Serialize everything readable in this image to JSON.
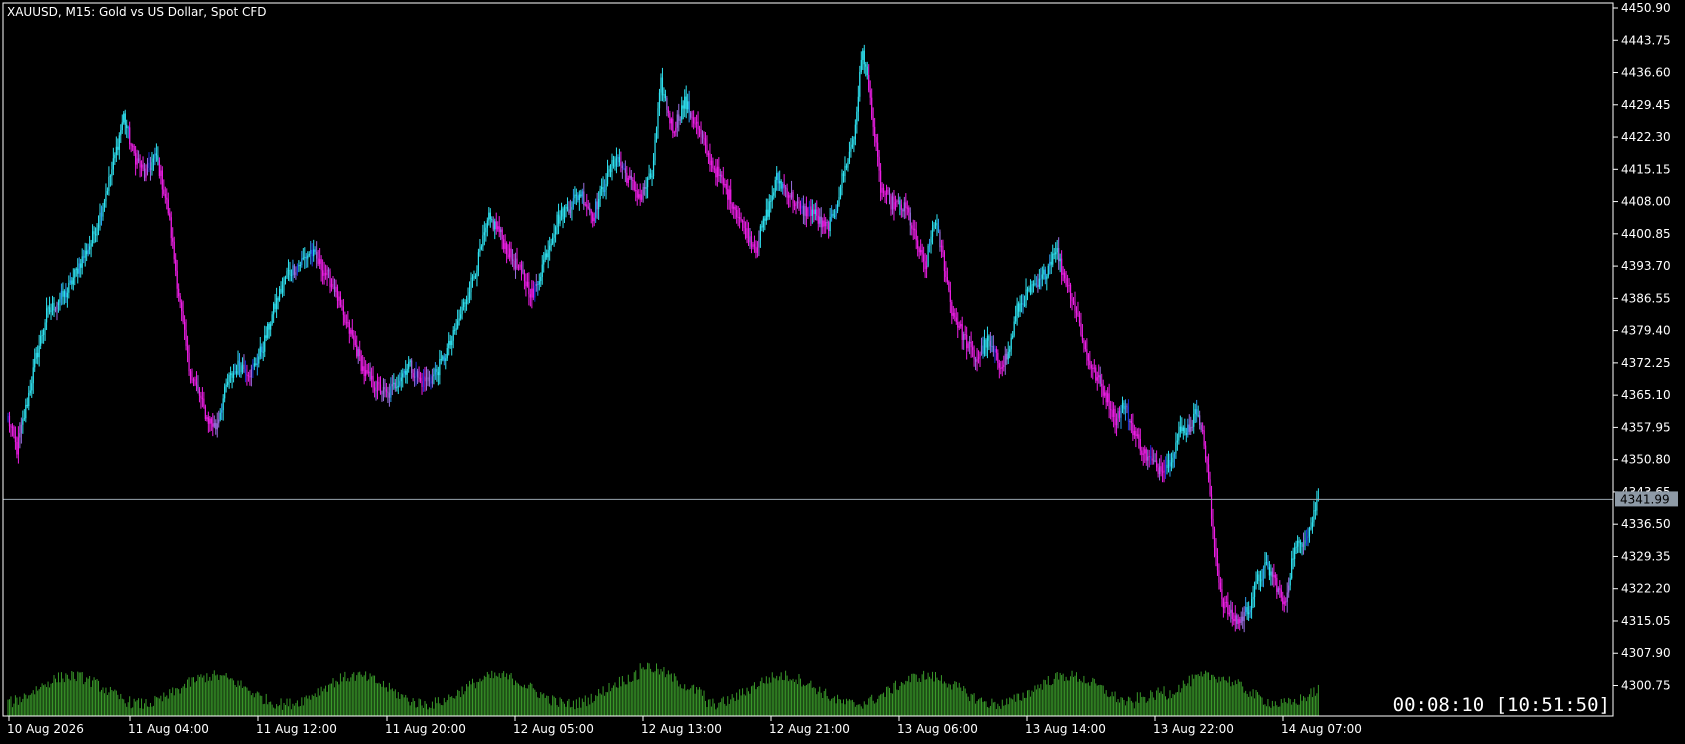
{
  "chart_data": {
    "type": "candlestick",
    "title": "XAUUSD, M15:  Gold vs US Dollar, Spot CFD",
    "symbol": "XAUUSD",
    "timeframe": "M15",
    "description": "Gold vs US Dollar, Spot CFD",
    "ylim": [
      4296.5,
      4452.5
    ],
    "grid": false,
    "y_ticks": [
      "4450.90",
      "4443.75",
      "4436.60",
      "4429.45",
      "4422.30",
      "4415.15",
      "4408.00",
      "4400.85",
      "4393.70",
      "4386.55",
      "4379.40",
      "4372.25",
      "4365.10",
      "4357.95",
      "4350.80",
      "4343.65",
      "4336.50",
      "4329.35",
      "4322.20",
      "4315.05",
      "4307.90",
      "4300.75"
    ],
    "x_ticks": [
      "10 Aug 2026",
      "11 Aug 04:00",
      "11 Aug 12:00",
      "11 Aug 20:00",
      "12 Aug 05:00",
      "12 Aug 13:00",
      "12 Aug 21:00",
      "13 Aug 06:00",
      "13 Aug 14:00",
      "13 Aug 22:00",
      "14 Aug 07:00"
    ],
    "current_price": 4341.99,
    "current_price_label": "4341.99",
    "timer": "00:08:10 [10:51:50]",
    "candle_colors": {
      "up": "#2fe3f2",
      "down": "#ee1ee6",
      "up_strong": "#2a9df0",
      "neutral": "#9a6fe0",
      "dark": "#1a2ad8"
    },
    "volume_color": "#3a9a2a",
    "price_line_color": "#9aa6b0",
    "close_path_anchors": [
      [
        0,
        4360
      ],
      [
        6,
        4353
      ],
      [
        12,
        4362
      ],
      [
        18,
        4372
      ],
      [
        26,
        4383
      ],
      [
        34,
        4386
      ],
      [
        40,
        4388
      ],
      [
        48,
        4394
      ],
      [
        56,
        4399
      ],
      [
        62,
        4405
      ],
      [
        70,
        4415
      ],
      [
        78,
        4427
      ],
      [
        84,
        4419
      ],
      [
        92,
        4414
      ],
      [
        100,
        4418
      ],
      [
        108,
        4406
      ],
      [
        116,
        4385
      ],
      [
        122,
        4371
      ],
      [
        128,
        4366
      ],
      [
        134,
        4360
      ],
      [
        140,
        4358
      ],
      [
        148,
        4368
      ],
      [
        156,
        4372
      ],
      [
        164,
        4370
      ],
      [
        172,
        4376
      ],
      [
        180,
        4385
      ],
      [
        188,
        4392
      ],
      [
        196,
        4394
      ],
      [
        204,
        4397
      ],
      [
        212,
        4393
      ],
      [
        220,
        4389
      ],
      [
        226,
        4382
      ],
      [
        232,
        4378
      ],
      [
        240,
        4370
      ],
      [
        248,
        4367
      ],
      [
        256,
        4365
      ],
      [
        262,
        4368
      ],
      [
        270,
        4372
      ],
      [
        278,
        4368
      ],
      [
        286,
        4369
      ],
      [
        292,
        4372
      ],
      [
        300,
        4378
      ],
      [
        308,
        4386
      ],
      [
        316,
        4394
      ],
      [
        324,
        4404
      ],
      [
        330,
        4402
      ],
      [
        338,
        4396
      ],
      [
        346,
        4392
      ],
      [
        354,
        4387
      ],
      [
        362,
        4396
      ],
      [
        370,
        4404
      ],
      [
        378,
        4407
      ],
      [
        386,
        4410
      ],
      [
        394,
        4405
      ],
      [
        402,
        4412
      ],
      [
        410,
        4418
      ],
      [
        418,
        4413
      ],
      [
        426,
        4409
      ],
      [
        434,
        4414
      ],
      [
        440,
        4434
      ],
      [
        448,
        4424
      ],
      [
        456,
        4430
      ],
      [
        464,
        4425
      ],
      [
        472,
        4418
      ],
      [
        480,
        4413
      ],
      [
        488,
        4408
      ],
      [
        496,
        4402
      ],
      [
        504,
        4398
      ],
      [
        512,
        4406
      ],
      [
        518,
        4413
      ],
      [
        526,
        4410
      ],
      [
        534,
        4406
      ],
      [
        542,
        4406
      ],
      [
        550,
        4402
      ],
      [
        556,
        4404
      ],
      [
        562,
        4413
      ],
      [
        570,
        4422
      ],
      [
        576,
        4442
      ],
      [
        582,
        4428
      ],
      [
        588,
        4411
      ],
      [
        594,
        4408
      ],
      [
        600,
        4407
      ],
      [
        606,
        4406
      ],
      [
        612,
        4399
      ],
      [
        618,
        4393
      ],
      [
        624,
        4404
      ],
      [
        630,
        4396
      ],
      [
        636,
        4384
      ],
      [
        644,
        4378
      ],
      [
        652,
        4373
      ],
      [
        660,
        4377
      ],
      [
        668,
        4372
      ],
      [
        674,
        4374
      ],
      [
        680,
        4384
      ],
      [
        688,
        4388
      ],
      [
        694,
        4389
      ],
      [
        700,
        4393
      ],
      [
        706,
        4398
      ],
      [
        710,
        4393
      ],
      [
        716,
        4388
      ],
      [
        722,
        4381
      ],
      [
        726,
        4375
      ],
      [
        732,
        4370
      ],
      [
        740,
        4365
      ],
      [
        746,
        4360
      ],
      [
        752,
        4363
      ],
      [
        760,
        4356
      ],
      [
        766,
        4352
      ],
      [
        774,
        4349
      ],
      [
        782,
        4350
      ],
      [
        790,
        4357
      ],
      [
        796,
        4358
      ],
      [
        802,
        4362
      ],
      [
        808,
        4350
      ],
      [
        812,
        4334
      ],
      [
        818,
        4320
      ],
      [
        824,
        4316
      ],
      [
        830,
        4315
      ],
      [
        836,
        4318
      ],
      [
        842,
        4324
      ],
      [
        848,
        4327
      ],
      [
        854,
        4324
      ],
      [
        860,
        4318
      ],
      [
        866,
        4330
      ],
      [
        872,
        4333
      ],
      [
        878,
        4336
      ],
      [
        883,
        4343
      ]
    ]
  },
  "ui": {
    "chart_window": "XAUUSD,M15"
  }
}
